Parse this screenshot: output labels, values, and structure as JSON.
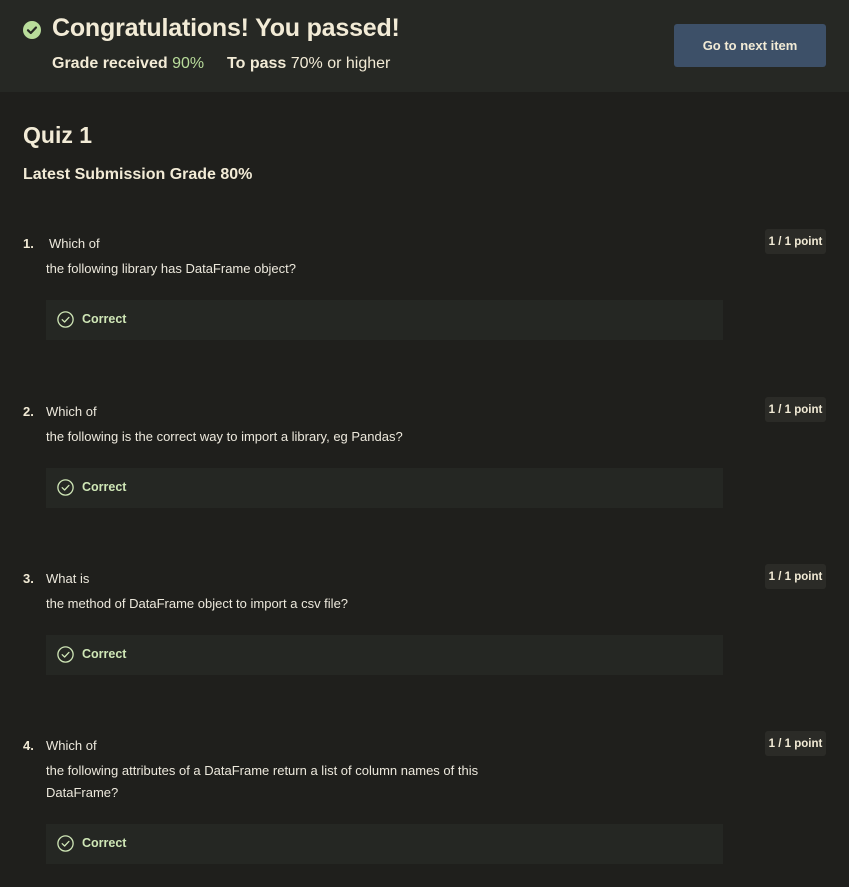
{
  "banner": {
    "title": "Congratulations! You passed!",
    "grade_label": "Grade received",
    "grade_value": "90%",
    "pass_label": "To pass",
    "pass_value": "70% or higher",
    "next_button": "Go to next item",
    "success_color": "#b9dd9b",
    "button_color": "#3d5068"
  },
  "quiz": {
    "title": "Quiz 1",
    "latest_submission": "Latest Submission Grade 80%"
  },
  "questions": [
    {
      "number": "1.",
      "first_line": "Which of",
      "rest": "the following library has DataFrame object?",
      "points": "1 / 1 point",
      "result": "Correct"
    },
    {
      "number": "2.",
      "first_line": "Which of",
      "rest": "the following is the correct way to import a library, eg Pandas?",
      "points": "1 / 1 point",
      "result": "Correct"
    },
    {
      "number": "3.",
      "first_line": "What is",
      "rest": "the method of DataFrame object to import a csv file?",
      "points": "1 / 1 point",
      "result": "Correct"
    },
    {
      "number": "4.",
      "first_line": "Which of",
      "rest": "the following attributes of a DataFrame return a list of column names of this DataFrame?",
      "points": "1 / 1 point",
      "result": "Correct"
    }
  ],
  "icons": {
    "banner": "check-circle-filled-icon",
    "result": "check-circle-outline-icon"
  }
}
